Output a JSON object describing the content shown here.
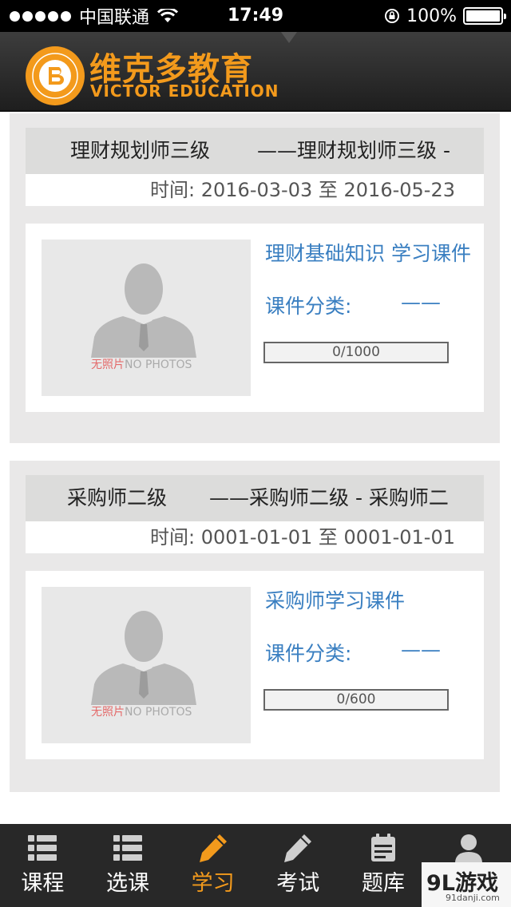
{
  "status_bar": {
    "carrier": "中国联通",
    "time": "17:49",
    "battery": "100%"
  },
  "header": {
    "brand_cn": "维克多教育",
    "brand_en": "VICTOR EDUCATION"
  },
  "courses": [
    {
      "title": "理财规划师三级",
      "subtitle": "——理财规划师三级 -",
      "time_label": "时间:",
      "start": "2016-03-03",
      "to": "至",
      "end": "2016-05-23",
      "photo_text_cn": "无照片",
      "photo_text_en": "NO PHOTOS",
      "course_name": "理财基础知识 学习课件",
      "category_label": "课件分类:",
      "category_value": "——",
      "progress": "0/1000"
    },
    {
      "title": "采购师二级",
      "subtitle": "——采购师二级 - 采购师二",
      "time_label": "时间:",
      "start": "0001-01-01",
      "to": "至",
      "end": "0001-01-01",
      "photo_text_cn": "无照片",
      "photo_text_en": "NO PHOTOS",
      "course_name": "采购师学习课件",
      "category_label": "课件分类:",
      "category_value": "——",
      "progress": "0/600"
    }
  ],
  "tabs": [
    {
      "label": "课程",
      "icon": "list-icon",
      "active": false
    },
    {
      "label": "选课",
      "icon": "list-icon",
      "active": false
    },
    {
      "label": "学习",
      "icon": "pencil-icon",
      "active": true
    },
    {
      "label": "考试",
      "icon": "pencil-icon",
      "active": false
    },
    {
      "label": "题库",
      "icon": "calendar-icon",
      "active": false
    },
    {
      "label": "",
      "icon": "user-icon",
      "active": false
    }
  ],
  "watermark": {
    "main": "9L游戏",
    "sub": "91danji.com"
  },
  "colors": {
    "brand_orange": "#f39a1c",
    "link_blue": "#3a7fc1",
    "tabbar_bg": "#282828"
  }
}
